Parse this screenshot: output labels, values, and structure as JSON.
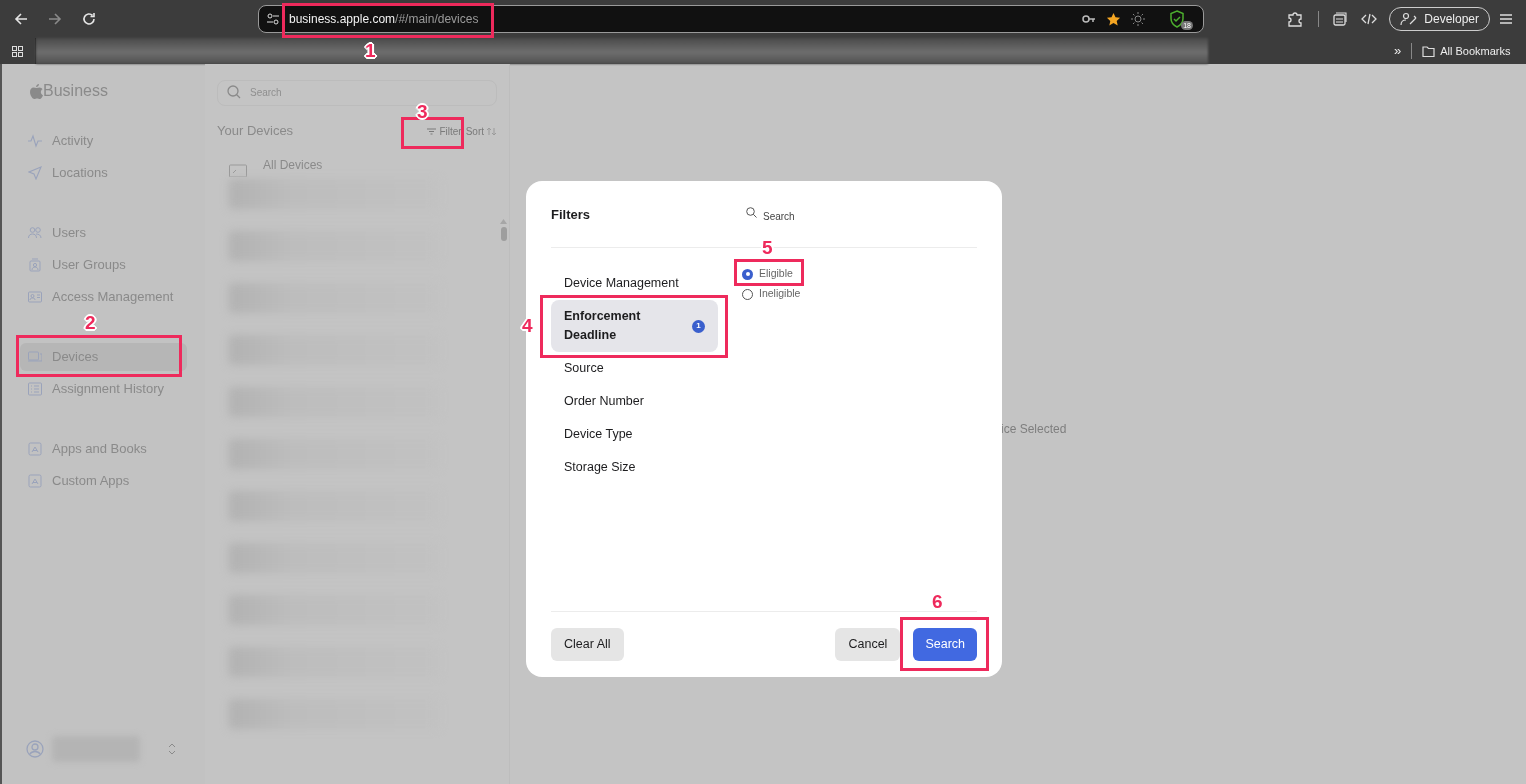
{
  "browser": {
    "url_host": "business.apple.com",
    "url_path": "/#/main/devices",
    "shield_badge": "18",
    "profile_button": "Developer",
    "bookmarks_overflow": "»",
    "bookmarks_folder": "All Bookmarks"
  },
  "sidebar": {
    "logo": "Business",
    "groups": [
      [
        {
          "label": "Activity",
          "selected": false
        },
        {
          "label": "Locations",
          "selected": false
        }
      ],
      [
        {
          "label": "Users",
          "selected": false
        },
        {
          "label": "User Groups",
          "selected": false
        },
        {
          "label": "Access Management",
          "selected": false
        }
      ],
      [
        {
          "label": "Devices",
          "selected": true
        },
        {
          "label": "Assignment History",
          "selected": false
        }
      ],
      [
        {
          "label": "Apps and Books",
          "selected": false
        },
        {
          "label": "Custom Apps",
          "selected": false
        }
      ]
    ]
  },
  "devices_list": {
    "search_placeholder": "Search",
    "title": "Your Devices",
    "filter_button": "Filter",
    "sort_button": "Sort",
    "first_row": "All Devices"
  },
  "detail": {
    "empty_text": "ice Selected"
  },
  "modal": {
    "title": "Filters",
    "search_placeholder": "Search",
    "categories": [
      {
        "label": "Device Management",
        "selected": false
      },
      {
        "label": "Enforcement Deadline",
        "selected": true,
        "badge": "1"
      },
      {
        "label": "Source",
        "selected": false
      },
      {
        "label": "Order Number",
        "selected": false
      },
      {
        "label": "Device Type",
        "selected": false
      },
      {
        "label": "Storage Size",
        "selected": false
      }
    ],
    "options": [
      {
        "label": "Eligible",
        "selected": true
      },
      {
        "label": "Ineligible",
        "selected": false
      }
    ],
    "buttons": {
      "clear": "Clear All",
      "cancel": "Cancel",
      "search": "Search"
    }
  },
  "annotations": [
    {
      "label": "1"
    },
    {
      "label": "2"
    },
    {
      "label": "3"
    },
    {
      "label": "4"
    },
    {
      "label": "5"
    },
    {
      "label": "6"
    }
  ]
}
